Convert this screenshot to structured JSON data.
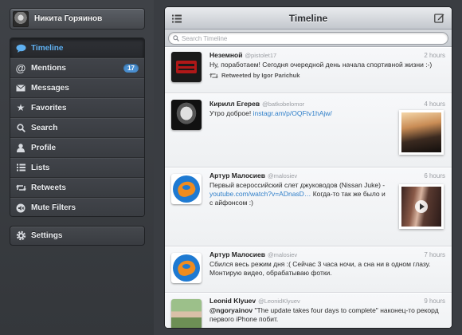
{
  "profile": {
    "name": "Никита Горяинов"
  },
  "nav": {
    "items": [
      {
        "label": "Timeline",
        "icon": "speech-bubble-icon",
        "active": true
      },
      {
        "label": "Mentions",
        "icon": "at-icon",
        "badge": "17"
      },
      {
        "label": "Messages",
        "icon": "envelope-icon"
      },
      {
        "label": "Favorites",
        "icon": "star-icon"
      },
      {
        "label": "Search",
        "icon": "search-icon"
      },
      {
        "label": "Profile",
        "icon": "person-icon"
      },
      {
        "label": "Lists",
        "icon": "list-icon"
      },
      {
        "label": "Retweets",
        "icon": "retweet-icon"
      },
      {
        "label": "Mute Filters",
        "icon": "mute-icon"
      }
    ],
    "settings_label": "Settings"
  },
  "header": {
    "title": "Timeline"
  },
  "search": {
    "placeholder": "Search Timeline"
  },
  "tweets": [
    {
      "name": "Неземной",
      "handle": "@pistolet17",
      "time": "2 hours",
      "text": "Ну, поработаем! Сегодня очередной день начала спортивной жизни :-)",
      "retweeted_by": "Retweeted by Igor Parichuk"
    },
    {
      "name": "Кирилл Егерев",
      "handle": "@batkobelomor",
      "time": "4 hours",
      "text": "Утро доброе!",
      "link": "instagr.am/p/OQFtv1hAjw/"
    },
    {
      "name": "Артур Малосиев",
      "handle": "@malosiev",
      "time": "6 hours",
      "text_before": "Первый всероссийский слет джуководов (Nissan Juke) -",
      "link": "youtube.com/watch?v=ADnasD…",
      "text_after": "Когда-то так же было и с айфонсом :)"
    },
    {
      "name": "Артур Малосиев",
      "handle": "@malosiev",
      "time": "7 hours",
      "text": "Сбился весь режим дня :( Сейчас 3 часа ночи, а сна ни в одном глазу. Монтирую видео, обрабатываю фотки."
    },
    {
      "name": "Leonid Klyuev",
      "handle": "@LeonidKlyuev",
      "time": "9 hours",
      "mention": "@ngoryainov",
      "text": "\"The update takes four days to complete\" наконец-то рекорд первого iPhone побит."
    }
  ],
  "colors": {
    "accent": "#64b5f6",
    "link": "#2f7fc9",
    "badge": "#4a8fd0"
  }
}
